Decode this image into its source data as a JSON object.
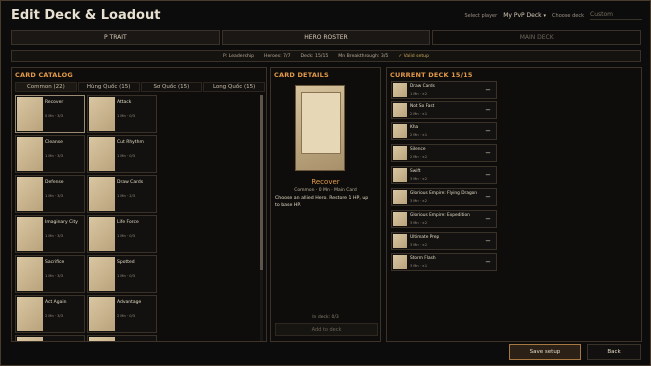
{
  "header": {
    "title": "Edit Deck & Loadout",
    "select_player_label": "Select player",
    "player_value": "My PvP Deck",
    "choose_deck_label": "Choose deck",
    "deck_value": "Custom"
  },
  "tabs": [
    {
      "label": "P TRAIT",
      "active": false
    },
    {
      "label": "HERO ROSTER",
      "active": false
    },
    {
      "label": "MAIN DECK",
      "active": true
    }
  ],
  "status": {
    "leadership": "P: Leadership",
    "heroes": "Heroes: 7/7",
    "deck": "Deck: 15/15",
    "breakthrough": "Mn Breakthrough: 3/5",
    "valid": "✓ Valid setup"
  },
  "catalog": {
    "title": "CARD CATALOG",
    "tabs": [
      {
        "label": "Common (22)",
        "active": true
      },
      {
        "label": "Hùng Quốc (15)",
        "active": false
      },
      {
        "label": "Sơ Quốc (15)",
        "active": false
      },
      {
        "label": "Long Quốc (15)",
        "active": false
      }
    ],
    "cards": [
      {
        "name": "Recover",
        "meta": "0 Mn · 3/3",
        "selected": true
      },
      {
        "name": "Attack",
        "meta": "1 Mn · 0/3",
        "selected": false
      },
      {
        "name": "Cleanse",
        "meta": "1 Mn · 3/3",
        "selected": false
      },
      {
        "name": "Cut Rhythm",
        "meta": "1 Mn · 0/3",
        "selected": false
      },
      {
        "name": "Defense",
        "meta": "1 Mn · 3/3",
        "selected": false
      },
      {
        "name": "Draw Cards",
        "meta": "1 Mn · 2/3",
        "selected": false
      },
      {
        "name": "Imaginary City",
        "meta": "1 Mn · 3/3",
        "selected": false
      },
      {
        "name": "Life Force",
        "meta": "1 Mn · 0/3",
        "selected": false
      },
      {
        "name": "Sacrifice",
        "meta": "1 Mn · 3/3",
        "selected": false
      },
      {
        "name": "Spotted",
        "meta": "1 Mn · 0/3",
        "selected": false
      },
      {
        "name": "Act Again",
        "meta": "2 Mn · 3/3",
        "selected": false
      },
      {
        "name": "Advantage",
        "meta": "2 Mn · 0/3",
        "selected": false
      },
      {
        "name": "",
        "meta": "",
        "selected": false
      },
      {
        "name": "",
        "meta": "",
        "selected": false
      }
    ]
  },
  "details": {
    "title": "CARD DETAILS",
    "card_name": "Recover",
    "card_sub": "Common · 0 Mn · Main Card",
    "description": "Choose an allied Hero. Restore 1 HP, up to base HP.",
    "in_deck": "In deck: 0/3",
    "add_button": "Add to deck"
  },
  "deck": {
    "title": "CURRENT DECK 15/15",
    "items": [
      {
        "name": "Draw Cards",
        "meta": "1 Mn · ×2"
      },
      {
        "name": "Not So Fast",
        "meta": "2 Mn · ×1"
      },
      {
        "name": "Kha",
        "meta": "2 Mn · ×1"
      },
      {
        "name": "Silence",
        "meta": "2 Mn · ×2"
      },
      {
        "name": "Swift",
        "meta": "3 Mn · ×2"
      },
      {
        "name": "Glorious Empire: Flying Dragon",
        "meta": "3 Mn · ×2"
      },
      {
        "name": "Glorious Empire: Expedition",
        "meta": "3 Mn · ×2"
      },
      {
        "name": "Ultimate Prep",
        "meta": "3 Mn · ×2"
      },
      {
        "name": "Storm Flash",
        "meta": "3 Mn · ×1"
      }
    ],
    "remove_symbol": "−"
  },
  "footer": {
    "save_label": "Save setup",
    "back_label": "Back"
  }
}
